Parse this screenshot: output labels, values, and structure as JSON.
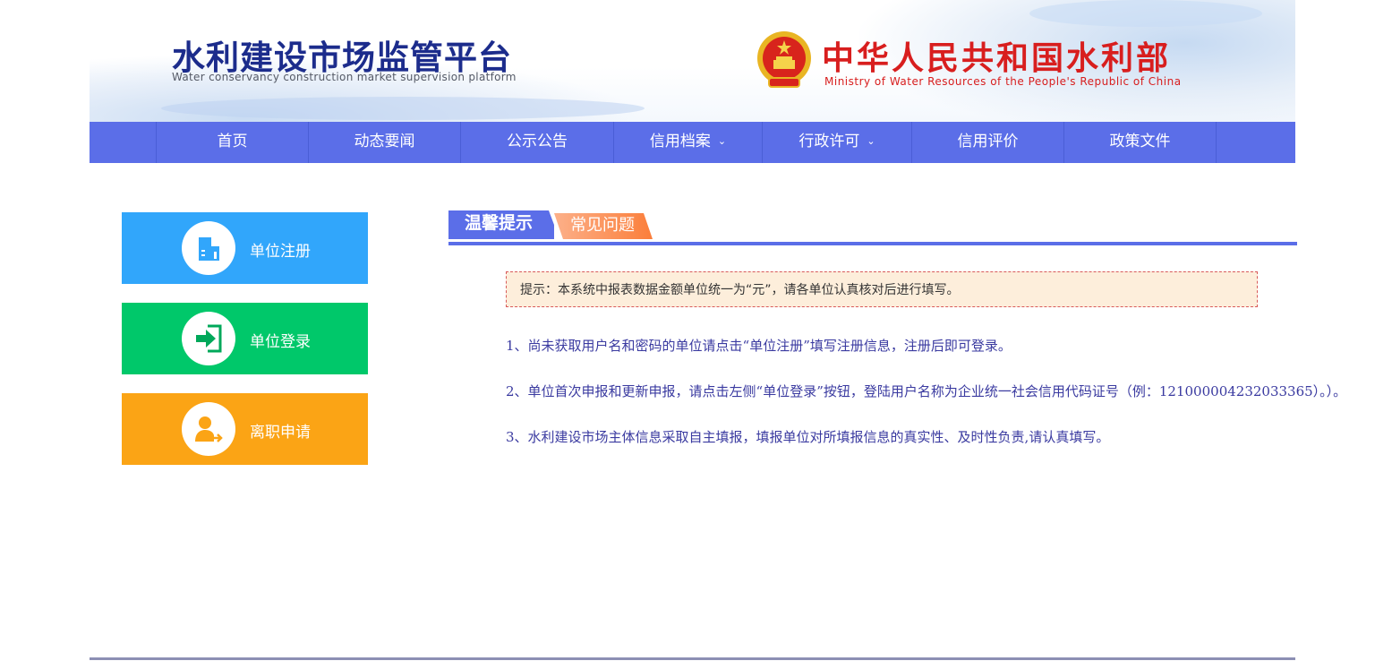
{
  "header": {
    "site_title": "水利建设市场监管平台",
    "site_subtitle": "Water conservancy construction market supervision platform",
    "ministry_title": "中华人民共和国水利部",
    "ministry_subtitle": "Ministry of Water Resources of the People's Republic of China",
    "emblem_icon": "national-emblem-icon"
  },
  "nav": {
    "items": [
      {
        "label": "首页",
        "dropdown": false
      },
      {
        "label": "动态要闻",
        "dropdown": false
      },
      {
        "label": "公示公告",
        "dropdown": false
      },
      {
        "label": "信用档案",
        "dropdown": true
      },
      {
        "label": "行政许可",
        "dropdown": true
      },
      {
        "label": "信用评价",
        "dropdown": false
      },
      {
        "label": "政策文件",
        "dropdown": false
      }
    ],
    "background": "#5b6ee8"
  },
  "sidebar": {
    "buttons": [
      {
        "label": "单位注册",
        "icon": "building-icon",
        "color": "#31a6fb"
      },
      {
        "label": "单位登录",
        "icon": "login-icon",
        "color": "#00c86a"
      },
      {
        "label": "离职申请",
        "icon": "user-leave-icon",
        "color": "#fba415"
      }
    ]
  },
  "tabs": {
    "active": "温馨提示",
    "inactive": "常见问题"
  },
  "notice": {
    "text": "提示：本系统中报表数据金额单位统一为“元”，请各单位认真核对后进行填写。"
  },
  "tips": [
    "1、尚未获取用户名和密码的单位请点击“单位注册”填写注册信息，注册后即可登录。",
    "2、单位首次申报和更新申报，请点击左侧“单位登录”按钮，登陆用户名称为企业统一社会信用代码证号（例：121000004232033365）。）。",
    "3、水利建设市场主体信息采取自主填报，填报单位对所填报信息的真实性、及时性负责,请认真填写。"
  ]
}
